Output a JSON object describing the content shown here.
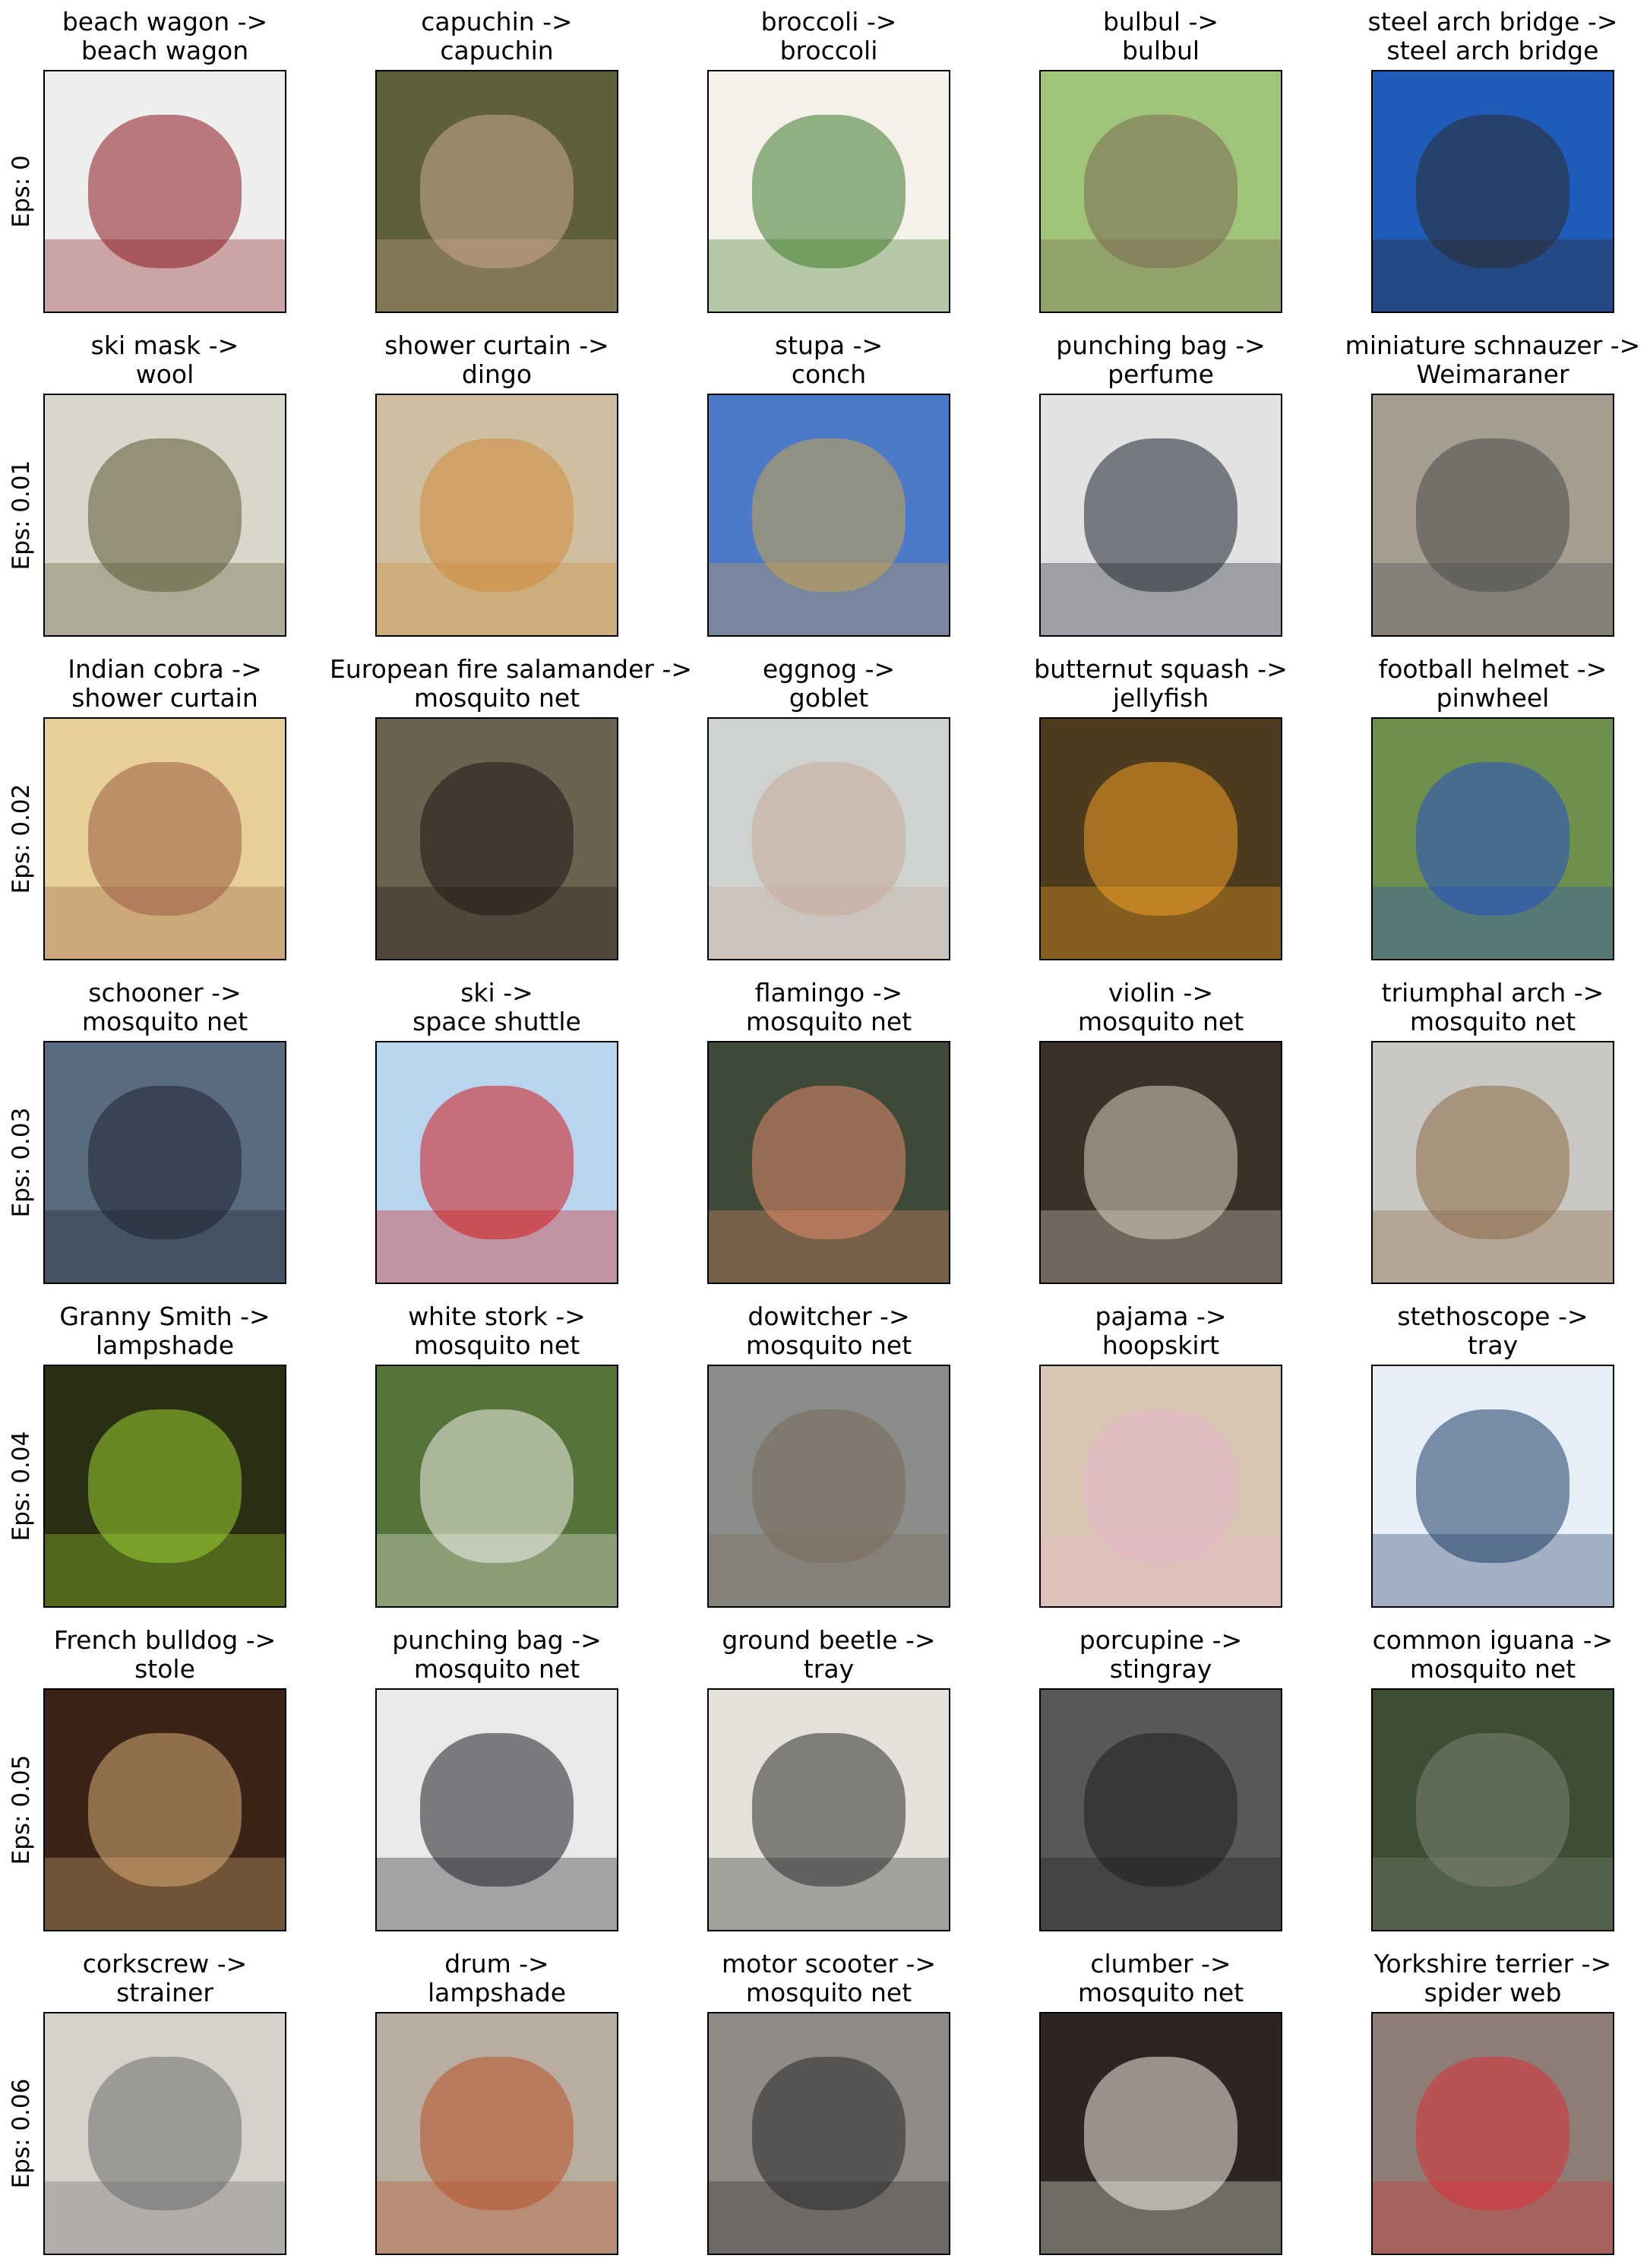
{
  "rows": [
    {
      "label": "Eps: 0",
      "cells": [
        {
          "from": "beach wagon ->",
          "to": "beach wagon",
          "bg": "#eeeeee",
          "fg": "#8b1a1f"
        },
        {
          "from": "capuchin ->",
          "to": "capuchin",
          "bg": "#5f5f3a",
          "fg": "#c9a98b"
        },
        {
          "from": "broccoli ->",
          "to": "broccoli",
          "bg": "#f3f1ea",
          "fg": "#3f7a2a"
        },
        {
          "from": "bulbul ->",
          "to": "bulbul",
          "bg": "#9fc47a",
          "fg": "#7a6a52"
        },
        {
          "from": "steel arch bridge ->",
          "to": "steel arch bridge",
          "bg": "#1f5bb8",
          "fg": "#2b2b2b"
        }
      ]
    },
    {
      "label": "Eps: 0.01",
      "cells": [
        {
          "from": "ski mask ->",
          "to": "wool",
          "bg": "#d9d6cc",
          "fg": "#5b5a33"
        },
        {
          "from": "shower curtain ->",
          "to": "dingo",
          "bg": "#cdbf9f",
          "fg": "#d08a3a"
        },
        {
          "from": "stupa ->",
          "to": "conch",
          "bg": "#4d79c9",
          "fg": "#c9a44a"
        },
        {
          "from": "punching bag ->",
          "to": "perfume",
          "bg": "#e2e2e2",
          "fg": "#1c2230"
        },
        {
          "from": "miniature schnauzer ->",
          "to": "Weimaraner",
          "bg": "#a49d90",
          "fg": "#4a4a4a"
        }
      ]
    },
    {
      "label": "Eps: 0.02",
      "cells": [
        {
          "from": "Indian cobra ->",
          "to": "shower curtain",
          "bg": "#e6cf99",
          "fg": "#9a5b42"
        },
        {
          "from": "European fire salamander ->",
          "to": "mosquito net",
          "bg": "#6d6152",
          "fg": "#1d1a12"
        },
        {
          "from": "eggnog ->",
          "to": "goblet",
          "bg": "#cfd3cf",
          "fg": "#c7a999"
        },
        {
          "from": "butternut squash ->",
          "to": "jellyfish",
          "bg": "#4d3b1e",
          "fg": "#f0a024"
        },
        {
          "from": "football helmet ->",
          "to": "pinwheel",
          "bg": "#6f8f4c",
          "fg": "#2450c4"
        }
      ]
    },
    {
      "label": "Eps: 0.03",
      "cells": [
        {
          "from": "schooner ->",
          "to": "mosquito net",
          "bg": "#5a6b80",
          "fg": "#1e2430"
        },
        {
          "from": "ski ->",
          "to": "space shuttle",
          "bg": "#b8d4ee",
          "fg": "#d21a1a"
        },
        {
          "from": "flamingo ->",
          "to": "mosquito net",
          "bg": "#3d4a38",
          "fg": "#e58a6a"
        },
        {
          "from": "violin ->",
          "to": "mosquito net",
          "bg": "#3b3129",
          "fg": "#d8cfc1"
        },
        {
          "from": "triumphal arch ->",
          "to": "mosquito net",
          "bg": "#c9c7c1",
          "fg": "#8b6a48"
        }
      ]
    },
    {
      "label": "Eps: 0.04",
      "cells": [
        {
          "from": "Granny Smith ->",
          "to": "lampshade",
          "bg": "#2a2f14",
          "fg": "#9bd12f"
        },
        {
          "from": "white stork ->",
          "to": "mosquito net",
          "bg": "#56743a",
          "fg": "#f0efe9"
        },
        {
          "from": "dowitcher ->",
          "to": "mosquito net",
          "bg": "#8a8d8a",
          "fg": "#7a6a55"
        },
        {
          "from": "pajama ->",
          "to": "hoopskirt",
          "bg": "#d7c6b2",
          "fg": "#e7b7c8"
        },
        {
          "from": "stethoscope ->",
          "to": "tray",
          "bg": "#e6eef7",
          "fg": "#1f3d66"
        }
      ]
    },
    {
      "label": "Eps: 0.05",
      "cells": [
        {
          "from": "French bulldog ->",
          "to": "stole",
          "bg": "#3a2418",
          "fg": "#d9ad74"
        },
        {
          "from": "punching bag ->",
          "to": "mosquito net",
          "bg": "#ebe9e7",
          "fg": "#1c1f27"
        },
        {
          "from": "ground beetle ->",
          "to": "tray",
          "bg": "#e4e1da",
          "fg": "#2b2d2b"
        },
        {
          "from": "porcupine ->",
          "to": "stingray",
          "bg": "#595757",
          "fg": "#1f1f1f"
        },
        {
          "from": "common iguana ->",
          "to": "mosquito net",
          "bg": "#3c4f35",
          "fg": "#7c8372"
        }
      ]
    },
    {
      "label": "Eps: 0.06",
      "cells": [
        {
          "from": "corkscrew ->",
          "to": "strainer",
          "bg": "#d6d2ca",
          "fg": "#6c6c6c"
        },
        {
          "from": "drum ->",
          "to": "lampshade",
          "bg": "#b8ad9e",
          "fg": "#b8522a"
        },
        {
          "from": "motor scooter ->",
          "to": "mosquito net",
          "bg": "#8f8b86",
          "fg": "#2a2a2a"
        },
        {
          "from": "clumber ->",
          "to": "mosquito net",
          "bg": "#2d2521",
          "fg": "#f1ede4"
        },
        {
          "from": "Yorkshire terrier ->",
          "to": "spider web",
          "bg": "#8e7d74",
          "fg": "#d8323a"
        }
      ]
    }
  ]
}
